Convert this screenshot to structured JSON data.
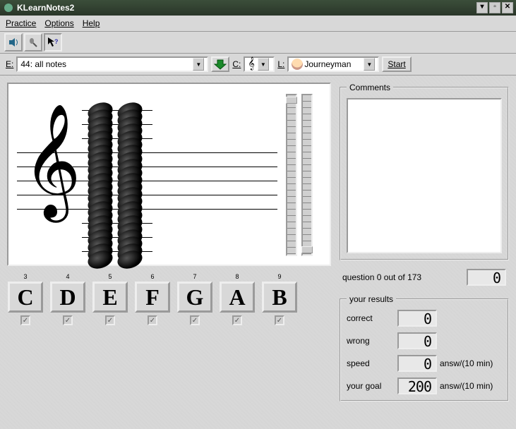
{
  "window": {
    "title": "KLearnNotes2"
  },
  "menu": {
    "practice": "Practice",
    "options": "Options",
    "help": "Help"
  },
  "params": {
    "e_label": "E:",
    "exercise": "44: all notes",
    "c_label": "C:",
    "l_label": "L:",
    "level": "Journeyman",
    "start": "Start"
  },
  "notes": [
    {
      "hotkey": "3",
      "label": "C"
    },
    {
      "hotkey": "4",
      "label": "D"
    },
    {
      "hotkey": "5",
      "label": "E"
    },
    {
      "hotkey": "6",
      "label": "F"
    },
    {
      "hotkey": "7",
      "label": "G"
    },
    {
      "hotkey": "8",
      "label": "A"
    },
    {
      "hotkey": "9",
      "label": "B"
    }
  ],
  "comments": {
    "legend": "Comments"
  },
  "question": {
    "text": "question 0 out of 173",
    "value": "0"
  },
  "results": {
    "legend": "your results",
    "correct_label": "correct",
    "correct": "0",
    "wrong_label": "wrong",
    "wrong": "0",
    "speed_label": "speed",
    "speed": "0",
    "speed_unit": "answ/(10 min)",
    "goal_label": "your goal",
    "goal": "200",
    "goal_unit": "answ/(10 min)"
  }
}
